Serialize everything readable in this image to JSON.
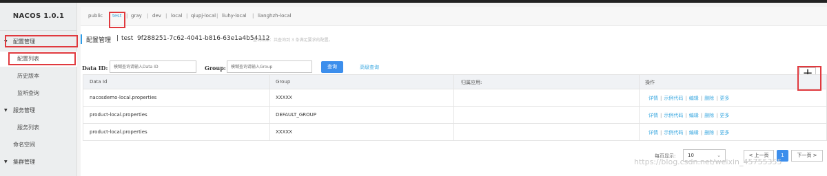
{
  "app": {
    "logo": "NACOS 1.0.1"
  },
  "sidebar": {
    "items": [
      {
        "label": "配置管理"
      },
      {
        "label": "配置列表"
      },
      {
        "label": "历史版本"
      },
      {
        "label": "监听查询"
      },
      {
        "label": "服务管理"
      },
      {
        "label": "服务列表"
      },
      {
        "label": "命名空间"
      },
      {
        "label": "集群管理"
      }
    ]
  },
  "namespaces": [
    "public",
    "test",
    "gray",
    "dev",
    "local",
    "qiupj-local",
    "liuhy-local",
    "lianghzh-local"
  ],
  "header": {
    "title": "配置管理",
    "separator": "|",
    "namespace_name": "test",
    "namespace_id": "9f288251-7c62-4041-b816-63e1a4b54112",
    "result_text": "查询结果：共查询到 3 条满足要求的配置。"
  },
  "search": {
    "dataid_label": "Data ID:",
    "dataid_placeholder": "模糊查询请输入Data ID",
    "group_label": "Group:",
    "group_placeholder": "模糊查询请输入Group",
    "query_button": "查询",
    "advanced_link": "高级查询",
    "add_button": "+"
  },
  "table": {
    "columns": [
      "Data Id",
      "Group",
      "归属应用:",
      "操作"
    ],
    "rows": [
      {
        "data_id": "nacosdemo-local.properties",
        "group": "XXXXX",
        "app": ""
      },
      {
        "data_id": "product-local.properties",
        "group": "DEFAULT_GROUP",
        "app": ""
      },
      {
        "data_id": "product-local.properties",
        "group": "XXXXX",
        "app": ""
      }
    ],
    "actions": [
      "详情",
      "示例代码",
      "编辑",
      "删除",
      "更多"
    ]
  },
  "pagination": {
    "page_size_label": "每页显示:",
    "page_size": "10",
    "prev": "< 上一页",
    "current_page": "1",
    "next": "下一页 >"
  },
  "watermark": "https://blog.csdn.net/weixin_45755355",
  "colors": {
    "accent": "#3c8eec",
    "link": "#3ba8e0",
    "highlight": "#e0393e"
  }
}
